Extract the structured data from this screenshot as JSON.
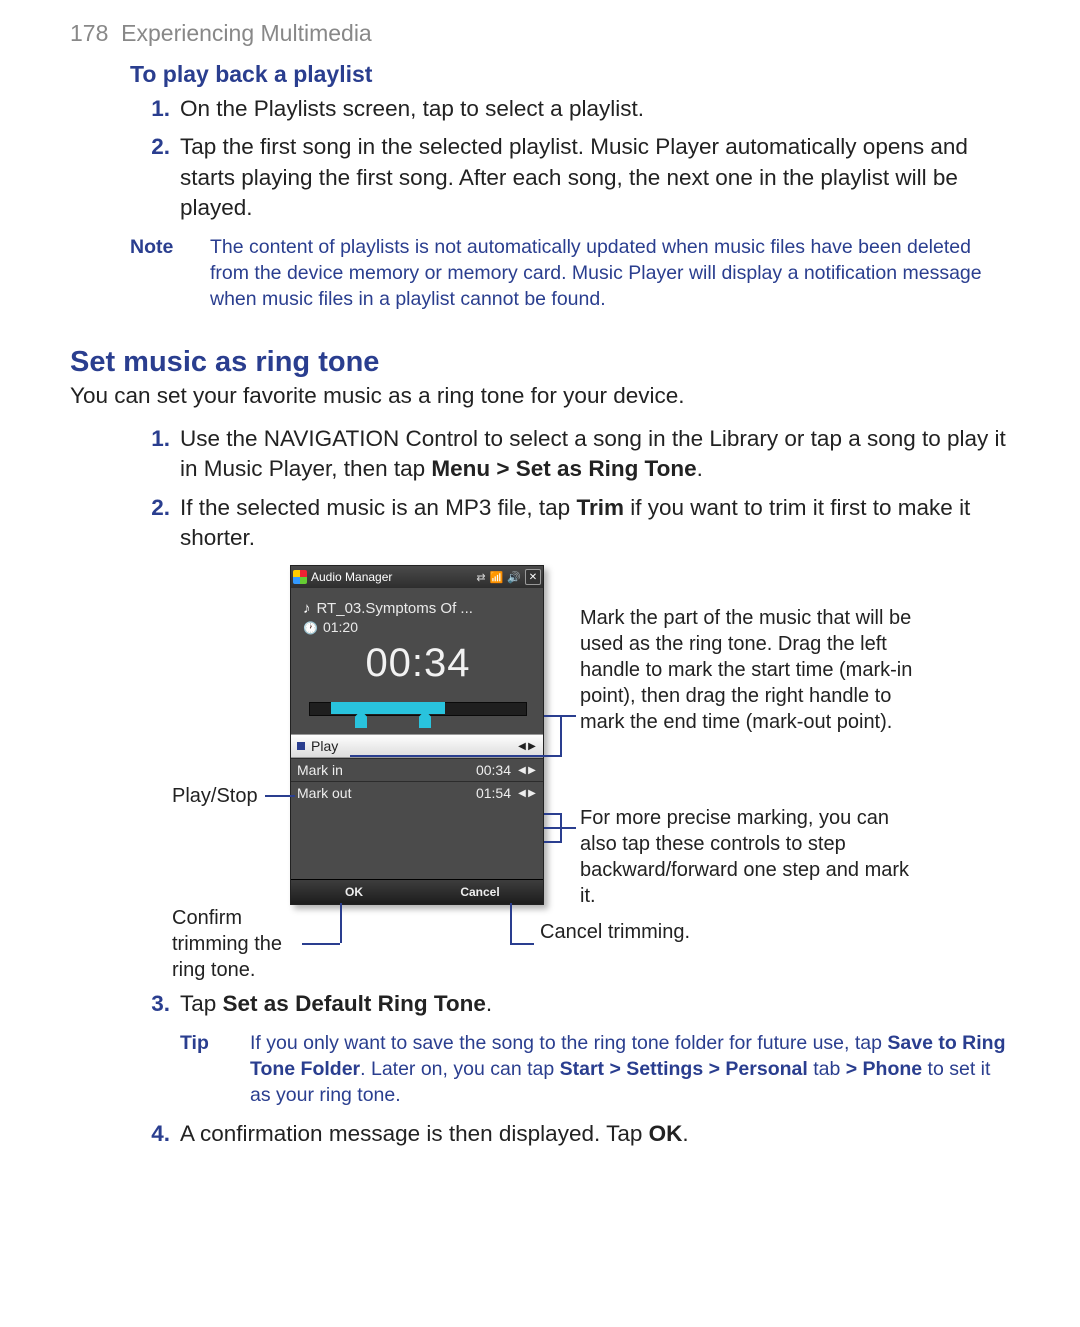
{
  "pageHeader": {
    "number": "178",
    "title": "Experiencing Multimedia"
  },
  "section_playlist": {
    "heading": "To play back a playlist",
    "items": [
      "On the Playlists screen, tap to select a playlist.",
      "Tap the first song in the selected playlist. Music Player automatically opens and starts playing the first song. After each song, the next one in the playlist will be played."
    ],
    "note_label": "Note",
    "note_text": "The content of playlists is not automatically updated when music files have been deleted from the device memory or memory card. Music Player will display a notification message when music files in a playlist cannot be found."
  },
  "section_ringtone": {
    "heading": "Set music as ring tone",
    "intro": "You can set your favorite music as a ring tone for your device.",
    "step1_a": "Use the NAVIGATION Control to select a song in the Library or tap a song to play it in Music Player, then tap ",
    "step1_bold": "Menu > Set as Ring Tone",
    "step1_b": ".",
    "step2_a": "If the selected music is an MP3 file, tap ",
    "step2_bold": "Trim",
    "step2_b": " if you want to trim it first to make it shorter.",
    "step3_a": "Tap ",
    "step3_bold": "Set as Default Ring Tone",
    "step3_b": ".",
    "tip_label": "Tip",
    "tip_a": "If you only want to save the song to the ring tone folder for future use, tap ",
    "tip_b1": "Save to Ring Tone Folder",
    "tip_c": ". Later on, you can tap ",
    "tip_b2": "Start > Settings > Personal",
    "tip_d": " tab ",
    "tip_b3": "> Phone",
    "tip_e": " to set it as your ring tone.",
    "step4_a": "A confirmation message is then displayed. Tap ",
    "step4_bold": "OK",
    "step4_b": "."
  },
  "phone": {
    "title": "Audio Manager",
    "track": "RT_03.Symptoms Of ...",
    "duration": "01:20",
    "big_time": "00:34",
    "rows": {
      "play": "Play",
      "mark_in": "Mark in",
      "mark_in_time": "00:34",
      "mark_out": "Mark out",
      "mark_out_time": "01:54"
    },
    "ok": "OK",
    "cancel": "Cancel"
  },
  "callouts": {
    "playstop": "Play/Stop",
    "confirm": "Confirm trimming the ring tone.",
    "cancel": "Cancel trimming.",
    "mark": "Mark the part of the music that will be used as the ring tone. Drag the left handle to mark the start time (mark-in point), then drag the right handle to mark the end time (mark-out point).",
    "precise": "For more precise marking, you can also tap these controls to step backward/forward one step and mark it."
  }
}
